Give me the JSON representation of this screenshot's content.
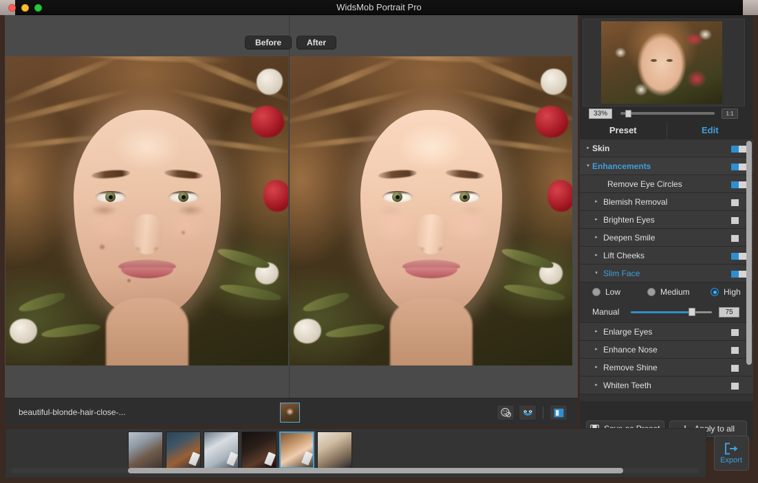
{
  "window": {
    "title": "WidsMob Portrait Pro",
    "traffic_lights": [
      "close",
      "minimize",
      "zoom"
    ]
  },
  "canvas": {
    "before_label": "Before",
    "after_label": "After"
  },
  "infobar": {
    "filename": "beautiful-blonde-hair-close-...",
    "icons": [
      {
        "name": "no-face-icon",
        "title": "Hide face marks"
      },
      {
        "name": "face-detect-icon",
        "title": "Face detection"
      },
      {
        "name": "split-view-icon",
        "title": "Split view"
      }
    ]
  },
  "navigator": {
    "zoom_value": "33%",
    "fit_label": "1:1",
    "zoom_percent": 33
  },
  "tabs": [
    {
      "label": "Preset",
      "active": false
    },
    {
      "label": "Edit",
      "active": true
    }
  ],
  "options": [
    {
      "label": "Skin",
      "arrow": "▸",
      "expanded": false,
      "child": false,
      "bold": true,
      "accent": false,
      "toggle": "on"
    },
    {
      "label": "Enhancements",
      "arrow": "▾",
      "expanded": true,
      "child": false,
      "bold": true,
      "accent": true,
      "toggle": "on"
    },
    {
      "label": "Remove Eye Circles",
      "arrow": "",
      "expanded": false,
      "child": true,
      "bold": false,
      "accent": false,
      "toggle": "on"
    },
    {
      "label": "Blemish Removal",
      "arrow": "▸",
      "expanded": false,
      "child": true,
      "bold": false,
      "accent": false,
      "toggle": "off"
    },
    {
      "label": "Brighten Eyes",
      "arrow": "▸",
      "expanded": false,
      "child": true,
      "bold": false,
      "accent": false,
      "toggle": "off"
    },
    {
      "label": "Deepen Smile",
      "arrow": "▸",
      "expanded": false,
      "child": true,
      "bold": false,
      "accent": false,
      "toggle": "off"
    },
    {
      "label": "Lift Cheeks",
      "arrow": "▸",
      "expanded": false,
      "child": true,
      "bold": false,
      "accent": false,
      "toggle": "on"
    },
    {
      "label": "Slim Face",
      "arrow": "▾",
      "expanded": true,
      "child": true,
      "bold": false,
      "accent": true,
      "toggle": "on"
    }
  ],
  "slim_face": {
    "levels": [
      {
        "label": "Low",
        "selected": false
      },
      {
        "label": "Medium",
        "selected": false
      },
      {
        "label": "High",
        "selected": true
      }
    ],
    "manual_label": "Manual",
    "manual_value": "75",
    "manual_percent": 75
  },
  "options_after": [
    {
      "label": "Enlarge Eyes",
      "arrow": "▸",
      "expanded": false,
      "child": true,
      "bold": false,
      "accent": false,
      "toggle": "off"
    },
    {
      "label": "Enhance Nose",
      "arrow": "▸",
      "expanded": false,
      "child": true,
      "bold": false,
      "accent": false,
      "toggle": "off"
    },
    {
      "label": "Remove Shine",
      "arrow": "▸",
      "expanded": false,
      "child": true,
      "bold": false,
      "accent": false,
      "toggle": "off"
    },
    {
      "label": "Whiten Teeth",
      "arrow": "▸",
      "expanded": false,
      "child": true,
      "bold": false,
      "accent": false,
      "toggle": "off"
    }
  ],
  "side_actions": {
    "save_preset_label": "Save as Preset",
    "apply_all_label": "Apply to all",
    "save_icon": "floppy-disk-icon",
    "apply_icon": "plus-icon"
  },
  "filmstrip": {
    "items": [
      {
        "index": 1,
        "selected": false,
        "has_badge": false,
        "bg": "linear-gradient(150deg,#b9c3cc 0%,#8f9aa6 32%,#6f5a4a 62%,#3e3632 100%)"
      },
      {
        "index": 2,
        "selected": false,
        "has_badge": true,
        "bg": "linear-gradient(150deg,#2e4352 0%,#3c5568 30%,#9b5f34 64%,#2a2f38 100%)"
      },
      {
        "index": 3,
        "selected": false,
        "has_badge": true,
        "bg": "linear-gradient(150deg,#6d7c8a 0%,#d8dde2 36%,#aab4bd 68%,#4a5560 100%)"
      },
      {
        "index": 4,
        "selected": false,
        "has_badge": true,
        "bg": "linear-gradient(150deg,#14100e 0%,#2a1f1a 40%,#5c3a2a 70%,#100c0a 100%)"
      },
      {
        "index": 5,
        "selected": true,
        "has_badge": true,
        "bg": "linear-gradient(150deg,#7e5634 0%,#c99a6e 35%,#efcdb0 58%,#4b3c22 100%)"
      },
      {
        "index": 6,
        "selected": false,
        "has_badge": false,
        "bg": "linear-gradient(150deg,#e6dfd6 0%,#d0bda2 34%,#8b7760 66%,#2a2a30 100%)"
      }
    ]
  },
  "export": {
    "label": "Export",
    "icon": "export-arrow-icon"
  },
  "colors": {
    "accent": "#3fa0dd",
    "toggle_on": "#2e8fd0",
    "panel_bg": "#2b2b2b",
    "row_bg": "#383838",
    "canvas_bg": "#4a4a4a"
  }
}
